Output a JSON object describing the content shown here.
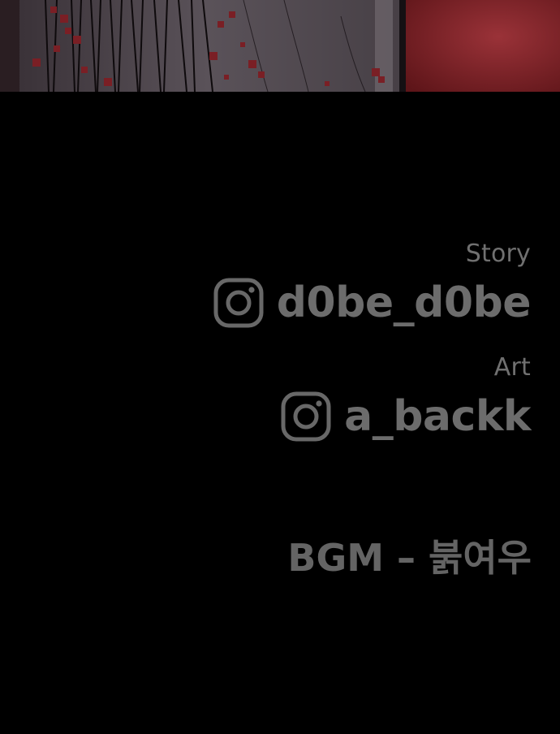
{
  "credits": {
    "story": {
      "role": "Story",
      "icon": "instagram-icon",
      "handle": "d0be_d0be"
    },
    "art": {
      "role": "Art",
      "icon": "instagram-icon",
      "handle": "a_backk"
    },
    "bgm": "BGM – 붉여우"
  },
  "colors": {
    "background": "#000000",
    "text": "#666666",
    "art_red": "#8a2a30"
  }
}
